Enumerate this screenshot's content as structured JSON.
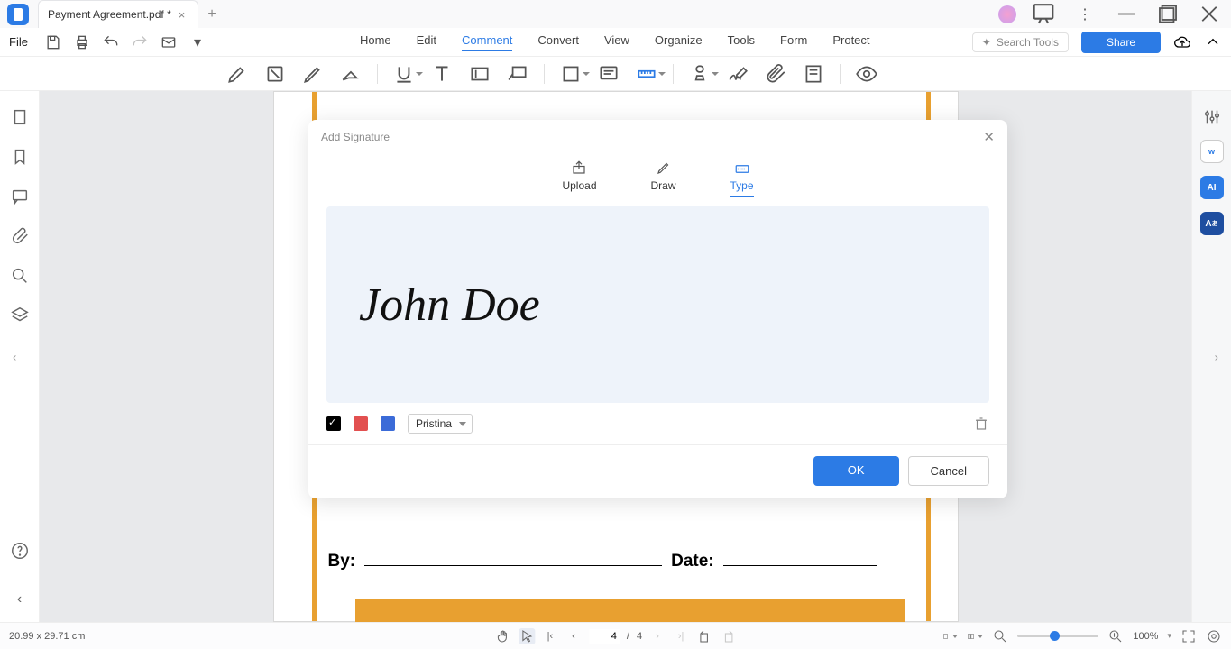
{
  "titlebar": {
    "tab_title": "Payment Agreement.pdf *"
  },
  "menubar": {
    "file": "File",
    "menus": [
      "Home",
      "Edit",
      "Comment",
      "Convert",
      "View",
      "Organize",
      "Tools",
      "Form",
      "Protect"
    ],
    "active_index": 2,
    "search_placeholder": "Search Tools",
    "share": "Share"
  },
  "signature": {
    "title": "Add Signature",
    "tabs": {
      "upload": "Upload",
      "draw": "Draw",
      "type": "Type"
    },
    "active_tab": "type",
    "typed_value": "John Doe",
    "font": "Pristina",
    "ok": "OK",
    "cancel": "Cancel"
  },
  "document": {
    "by_label": "By:",
    "date_label": "Date:"
  },
  "statusbar": {
    "dimensions": "20.99 x 29.71 cm",
    "current_page": "4",
    "page_sep": "/",
    "total_pages": "4",
    "zoom": "100%"
  }
}
